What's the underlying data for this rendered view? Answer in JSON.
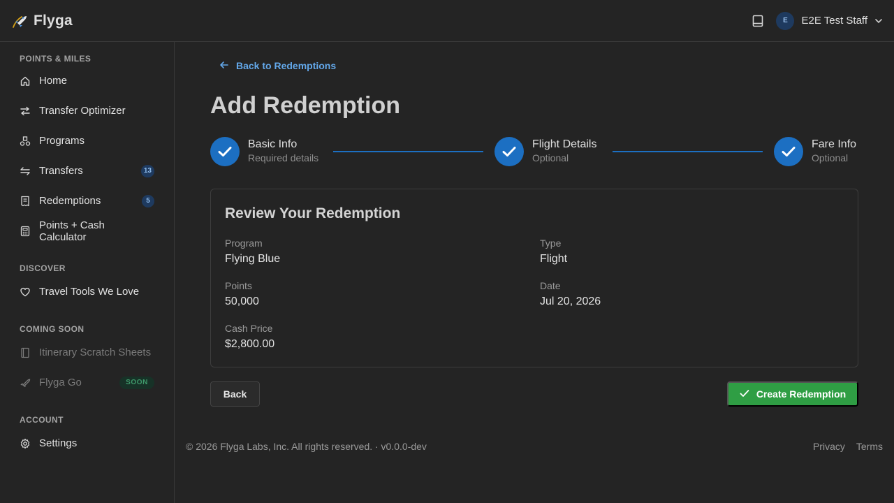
{
  "header": {
    "brand": "Flyga",
    "user_initial": "E",
    "user_name": "E2E Test Staff"
  },
  "sidebar": {
    "sections": [
      {
        "title": "POINTS & MILES",
        "items": [
          {
            "label": "Home",
            "icon": "home-icon"
          },
          {
            "label": "Transfer Optimizer",
            "icon": "arrows-swap-icon"
          },
          {
            "label": "Programs",
            "icon": "programs-icon"
          },
          {
            "label": "Transfers",
            "icon": "transfers-icon",
            "badge": "13"
          },
          {
            "label": "Redemptions",
            "icon": "receipt-icon",
            "badge": "5"
          },
          {
            "label": "Points + Cash Calculator",
            "icon": "calculator-icon"
          }
        ]
      },
      {
        "title": "DISCOVER",
        "items": [
          {
            "label": "Travel Tools We Love",
            "icon": "heart-icon"
          }
        ]
      },
      {
        "title": "COMING SOON",
        "items": [
          {
            "label": "Itinerary Scratch Sheets",
            "icon": "notebook-icon"
          },
          {
            "label": "Flyga Go",
            "icon": "rocket-icon",
            "badge": "SOON"
          }
        ]
      },
      {
        "title": "ACCOUNT",
        "items": [
          {
            "label": "Settings",
            "icon": "gear-icon"
          }
        ]
      }
    ]
  },
  "main": {
    "back_link": "Back to Redemptions",
    "title": "Add Redemption",
    "steps": [
      {
        "label": "Basic Info",
        "sub": "Required details",
        "status": "complete"
      },
      {
        "label": "Flight Details",
        "sub": "Optional",
        "status": "complete"
      },
      {
        "label": "Fare Info",
        "sub": "Optional",
        "status": "complete"
      }
    ],
    "review": {
      "title": "Review Your Redemption",
      "fields": {
        "program": {
          "label": "Program",
          "value": "Flying Blue"
        },
        "type": {
          "label": "Type",
          "value": "Flight"
        },
        "points": {
          "label": "Points",
          "value": "50,000"
        },
        "date": {
          "label": "Date",
          "value": "Jul 20, 2026"
        },
        "cash_price": {
          "label": "Cash Price",
          "value": "$2,800.00"
        }
      }
    },
    "back_button": "Back",
    "create_button": "Create Redemption"
  },
  "footer": {
    "copyright": "© 2026 Flyga Labs, Inc. All rights reserved. · v0.0.0-dev",
    "links": [
      "Privacy",
      "Terms"
    ]
  },
  "colors": {
    "background": "#242424",
    "accent_blue": "#1c6fc2",
    "link_blue": "#63a8ea",
    "success_green": "#2f9e44"
  }
}
